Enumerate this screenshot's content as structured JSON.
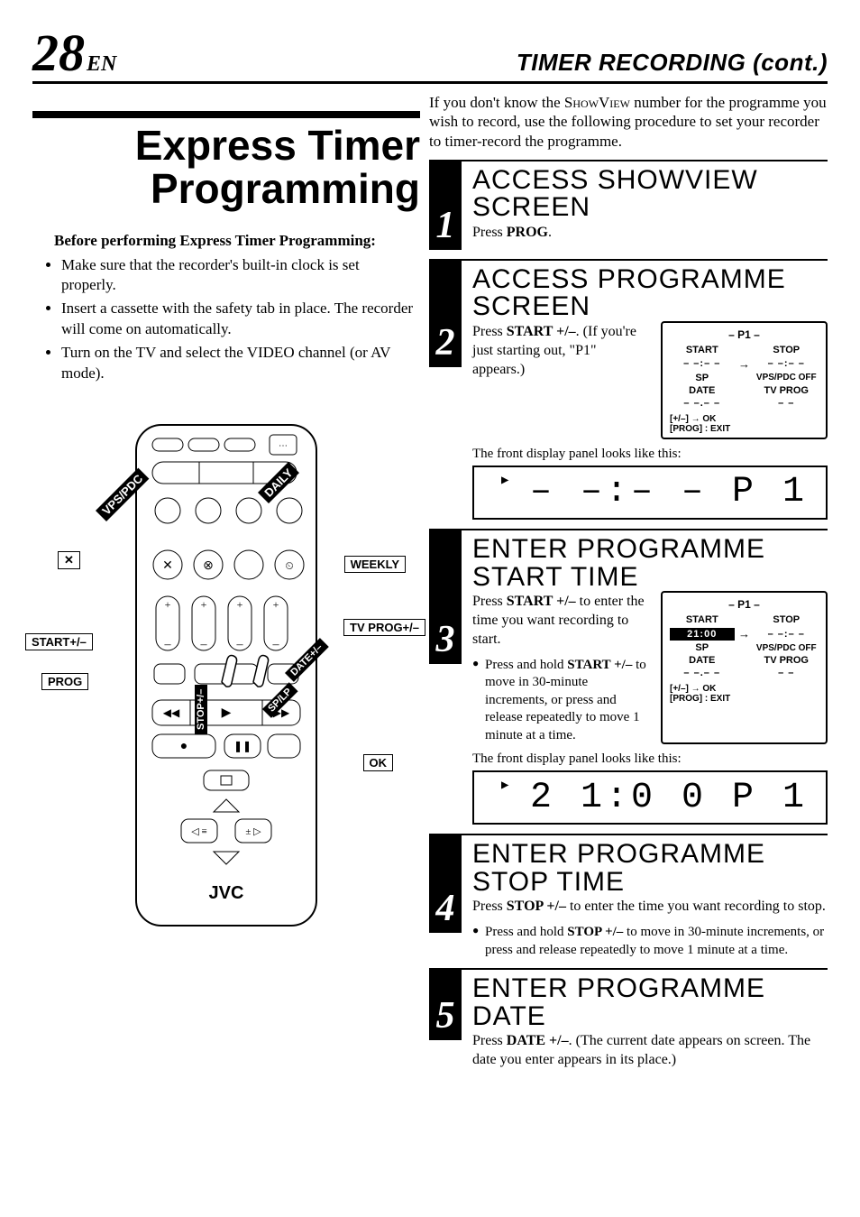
{
  "page": {
    "number": "28",
    "lang": "EN",
    "section": "TIMER RECORDING (cont.)"
  },
  "main_heading": "Express Timer Programming",
  "before": {
    "title": "Before performing Express Timer Programming:",
    "items": [
      "Make sure that the recorder's built-in clock is set properly.",
      "Insert a cassette with the safety tab in place. The recorder will come on automatically.",
      "Turn on the TV and select the VIDEO channel (or AV mode)."
    ]
  },
  "intro": {
    "pre": "If you don't know the ",
    "sv": "ShowView",
    "post": " number for the programme you wish to record, use the following procedure to set your recorder to timer-record the programme."
  },
  "steps": [
    {
      "num": "1",
      "title": "ACCESS SHOWVIEW SCREEN",
      "desc_pre": "Press ",
      "desc_b": "PROG",
      "desc_post": "."
    },
    {
      "num": "2",
      "title": "ACCESS PROGRAMME SCREEN",
      "desc_pre": "Press ",
      "desc_b": "START +/–",
      "desc_post": ". (If you're just starting out, \"P1\" appears.)",
      "osd": {
        "hdr": "– P1 –",
        "start_l": "START",
        "start_v": "– –:– –",
        "arrow": "→",
        "stop_l": "STOP",
        "stop_v": "– –:– –",
        "sp": "SP",
        "vps": "VPS/PDC OFF",
        "date_l": "DATE",
        "date_v": "– –.– –",
        "tv_l": "TV PROG",
        "tv_v": "– –",
        "foot1": "[+/–] → OK",
        "foot2": "[PROG] : EXIT"
      },
      "panel_label": "The front display panel looks like this:",
      "lcd": "– –:– –  P 1"
    },
    {
      "num": "3",
      "title": "ENTER PROGRAMME START TIME",
      "desc_pre": "Press ",
      "desc_b": "START +/–",
      "desc_post": " to enter the time you want recording to start.",
      "sub_pre": "Press and hold ",
      "sub_b": "START +/–",
      "sub_post": " to move in 30-minute increments, or press and release repeatedly to move 1 minute at a time.",
      "osd": {
        "hdr": "– P1 –",
        "start_l": "START",
        "start_v": "21:00",
        "start_hl": true,
        "arrow": "→",
        "stop_l": "STOP",
        "stop_v": "– –:– –",
        "sp": "SP",
        "vps": "VPS/PDC OFF",
        "date_l": "DATE",
        "date_v": "– –.– –",
        "tv_l": "TV PROG",
        "tv_v": "– –",
        "foot1": "[+/–] → OK",
        "foot2": "[PROG] : EXIT"
      },
      "panel_label": "The front display panel looks like this:",
      "lcd": "2 1:0 0  P 1"
    },
    {
      "num": "4",
      "title": "ENTER PROGRAMME STOP TIME",
      "desc_pre": "Press ",
      "desc_b": "STOP +/–",
      "desc_post": " to enter the time you want recording to stop.",
      "sub_pre": "Press and hold ",
      "sub_b": "STOP +/–",
      "sub_post": " to move in 30-minute increments, or press and release repeatedly to move 1 minute at a time."
    },
    {
      "num": "5",
      "title": "ENTER PROGRAMME DATE",
      "desc_pre": "Press ",
      "desc_b": "DATE +/–",
      "desc_post": ". (The current date appears on screen. The date you enter appears in its place.)"
    }
  ],
  "remote": {
    "brand": "JVC",
    "tags": {
      "weekly": "WEEKLY",
      "tvprog": "TV PROG+/–",
      "start": "START+/–",
      "prog": "PROG",
      "ok": "OK",
      "daily": "DAILY",
      "vpspdc": "VPS/PDC",
      "date": "DATE+/–",
      "stop": "STOP+/–",
      "splp": "SP/LP"
    }
  }
}
